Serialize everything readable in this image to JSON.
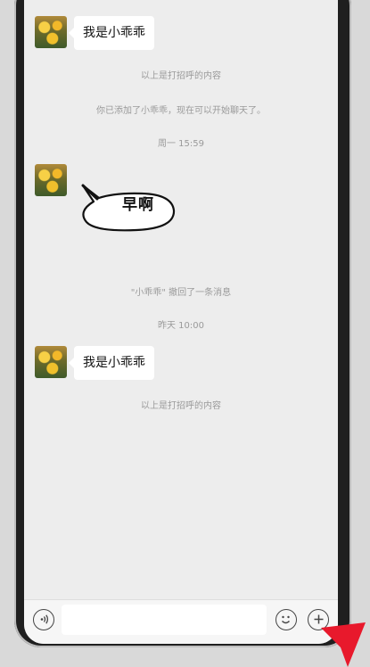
{
  "chat": {
    "messages": [
      {
        "type": "text",
        "text": "我是小乖乖"
      },
      {
        "type": "system",
        "text": "以上是打招呼的内容"
      },
      {
        "type": "system",
        "text": "你已添加了小乖乖，现在可以开始聊天了。"
      },
      {
        "type": "timestamp",
        "text": "周一 15:59"
      },
      {
        "type": "sticker",
        "text": "早啊"
      },
      {
        "type": "system",
        "text": "\"小乖乖\" 撤回了一条消息"
      },
      {
        "type": "timestamp",
        "text": "昨天 10:00"
      },
      {
        "type": "text",
        "text": "我是小乖乖"
      },
      {
        "type": "system",
        "text": "以上是打招呼的内容"
      }
    ]
  },
  "input_bar": {
    "voice_icon": "voice-icon",
    "text_value": "",
    "emoji_icon": "emoji-icon",
    "plus_icon": "plus-icon"
  },
  "colors": {
    "background": "#ededed",
    "bubble": "#ffffff",
    "system_text": "#9a9a9a",
    "cursor": "#e8192c"
  }
}
